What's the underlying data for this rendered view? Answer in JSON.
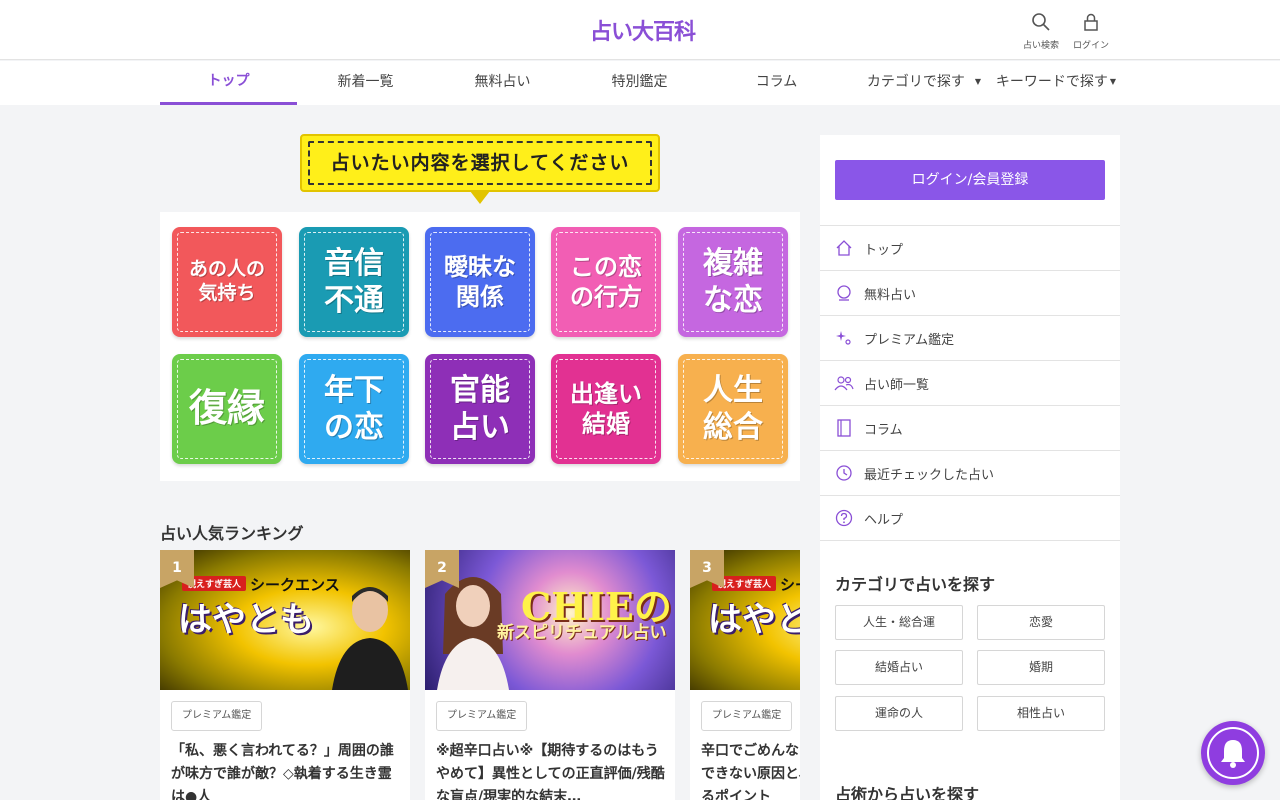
{
  "header": {
    "logo_text": "占い大百科",
    "search_label": "占い検索",
    "login_label": "ログイン"
  },
  "nav": {
    "items": [
      "トップ",
      "新着一覧",
      "無料占い",
      "特別鑑定",
      "コラム",
      "カテゴリで探す",
      "キーワードで探す"
    ],
    "active": "トップ"
  },
  "select_banner": "占いたい内容を選択してください",
  "categories": [
    {
      "label": "あの人の\n気持ち",
      "color": "#f2585b"
    },
    {
      "label": "音信\n不通",
      "color": "#1a9bb3"
    },
    {
      "label": "曖昧な\n関係",
      "color": "#4c6cf0"
    },
    {
      "label": "この恋\nの行方",
      "color": "#f25eb4"
    },
    {
      "label": "複雑\nな恋",
      "color": "#c567e0"
    },
    {
      "label": "復縁",
      "color": "#6ccd4a"
    },
    {
      "label": "年下\nの恋",
      "color": "#2faaf0"
    },
    {
      "label": "官能\n占い",
      "color": "#8e2fb7"
    },
    {
      "label": "出逢い\n結婚",
      "color": "#e23192"
    },
    {
      "label": "人生\n総合",
      "color": "#f7b04e"
    }
  ],
  "ranking": {
    "title": "占い人気ランキング",
    "cards": [
      {
        "rank": "1",
        "tag": "プレミアム鑑定",
        "title": "「私、悪く言われてる？」周囲の誰が味方で誰が敵？◇執着する生き霊は●人",
        "image_caption": "はやとも",
        "image_badge": "視えすぎ芸人",
        "image_sub": "シークエンス"
      },
      {
        "rank": "2",
        "tag": "プレミアム鑑定",
        "title": "※超辛口占い※【期待するのはもうやめて】異性としての正直評価/残酷な盲点/現実的な結末…",
        "image_caption": "CHIEの",
        "image_sub": "新スピリチュアル占い"
      },
      {
        "rank": "3",
        "tag": "プレミアム鑑定",
        "title": "辛口でごめんなさい。あなたが結婚できない原因と、運命の人を見分けるポイント",
        "image_caption": "はやとも",
        "image_badge": "視えすぎ芸人",
        "image_sub": "シークエンス"
      }
    ]
  },
  "sidebar": {
    "login_button": "ログイン/会員登録",
    "menu": [
      {
        "label": "トップ",
        "icon": "home-icon"
      },
      {
        "label": "無料占い",
        "icon": "crystal-ball-icon"
      },
      {
        "label": "プレミアム鑑定",
        "icon": "sparkle-icon"
      },
      {
        "label": "占い師一覧",
        "icon": "people-icon"
      },
      {
        "label": "コラム",
        "icon": "book-icon"
      },
      {
        "label": "最近チェックした占い",
        "icon": "history-icon"
      },
      {
        "label": "ヘルプ",
        "icon": "help-icon"
      }
    ],
    "category_heading": "カテゴリで占いを探す",
    "category_buttons": [
      "人生・総合運",
      "恋愛",
      "結婚占い",
      "婚期",
      "運命の人",
      "相性占い"
    ],
    "method_heading": "占術から占いを探す"
  },
  "colors": {
    "accent": "#8a4fd6",
    "login_button": "#8a56e8",
    "banner_yellow": "#ffef1a",
    "rank_badge": "#c8a465"
  }
}
